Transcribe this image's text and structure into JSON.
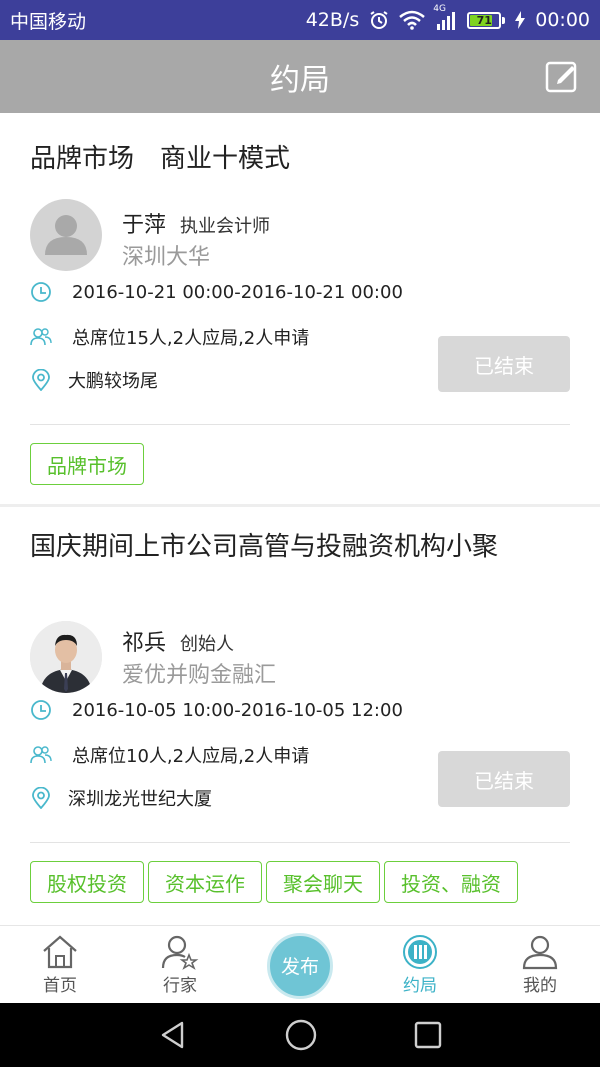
{
  "status_bar": {
    "carrier": "中国移动",
    "speed": "42B/s",
    "network": "4G",
    "battery": "71",
    "time": "00:00"
  },
  "header": {
    "title": "约局",
    "edit_icon": "edit-icon"
  },
  "events": [
    {
      "title": "品牌市场　商业十模式",
      "host_name": "于萍",
      "host_role": "执业会计师",
      "host_org": "深圳大华",
      "time": "2016-10-21 00:00-2016-10-21 00:00",
      "seats": "总席位15人,2人应局,2人申请",
      "location": "大鹏较场尾",
      "status": "已结束",
      "tags": [
        "品牌市场"
      ]
    },
    {
      "title": "国庆期间上市公司高管与投融资机构小聚",
      "host_name": "祁兵",
      "host_role": "创始人",
      "host_org": "爱优并购金融汇",
      "time": "2016-10-05 10:00-2016-10-05 12:00",
      "seats": "总席位10人,2人应局,2人申请",
      "location": "深圳龙光世纪大厦",
      "status": "已结束",
      "tags": [
        "股权投资",
        "资本运作",
        "聚会聊天",
        "投资、融资"
      ]
    }
  ],
  "tabbar": {
    "home": "首页",
    "experts": "行家",
    "publish": "发布",
    "meetups": "约局",
    "mine": "我的"
  },
  "colors": {
    "status_bar": "#3d3f9a",
    "header": "#a8a8a8",
    "tag_green": "#58c02c",
    "accent": "#3cb2c7"
  }
}
